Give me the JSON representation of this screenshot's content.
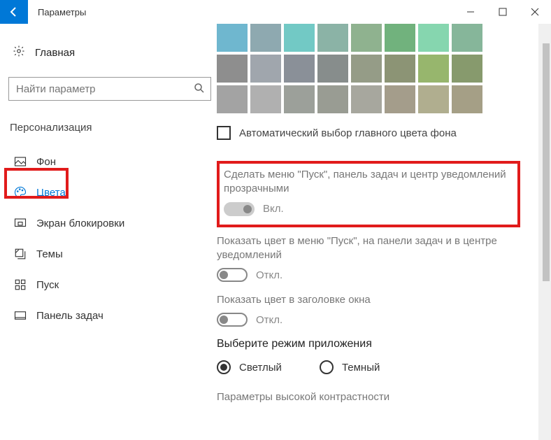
{
  "window": {
    "title": "Параметры"
  },
  "sidebar": {
    "home": "Главная",
    "search_placeholder": "Найти параметр",
    "section": "Персонализация",
    "items": [
      {
        "label": "Фон"
      },
      {
        "label": "Цвета"
      },
      {
        "label": "Экран блокировки"
      },
      {
        "label": "Темы"
      },
      {
        "label": "Пуск"
      },
      {
        "label": "Панель задач"
      }
    ]
  },
  "colors": {
    "swatches": [
      "#6fb7cf",
      "#8ea9b0",
      "#72c9c5",
      "#8bb3a6",
      "#8fb28f",
      "#71b27d",
      "#86d6af",
      "#86b69a",
      "#8e8e8e",
      "#a0a6ad",
      "#8a9098",
      "#878d8c",
      "#959c87",
      "#8c9475",
      "#97b66d",
      "#879a6d",
      "#a3a3a3",
      "#b0b0b0",
      "#9ca09a",
      "#999c93",
      "#a7a79e",
      "#a49d8b",
      "#b0ae8f",
      "#a59f86"
    ],
    "auto_checkbox": "Автоматический выбор главного цвета фона",
    "transparency_label": "Сделать меню \"Пуск\", панель задач и центр уведомлений прозрачными",
    "transparency_state": "Вкл.",
    "show_color_start_label": "Показать цвет в меню \"Пуск\", на панели задач и в центре уведомлений",
    "show_color_start_state": "Откл.",
    "show_color_title_label": "Показать цвет в заголовке окна",
    "show_color_title_state": "Откл.",
    "mode_title": "Выберите режим приложения",
    "mode_light": "Светлый",
    "mode_dark": "Темный",
    "high_contrast": "Параметры высокой контрастности"
  }
}
